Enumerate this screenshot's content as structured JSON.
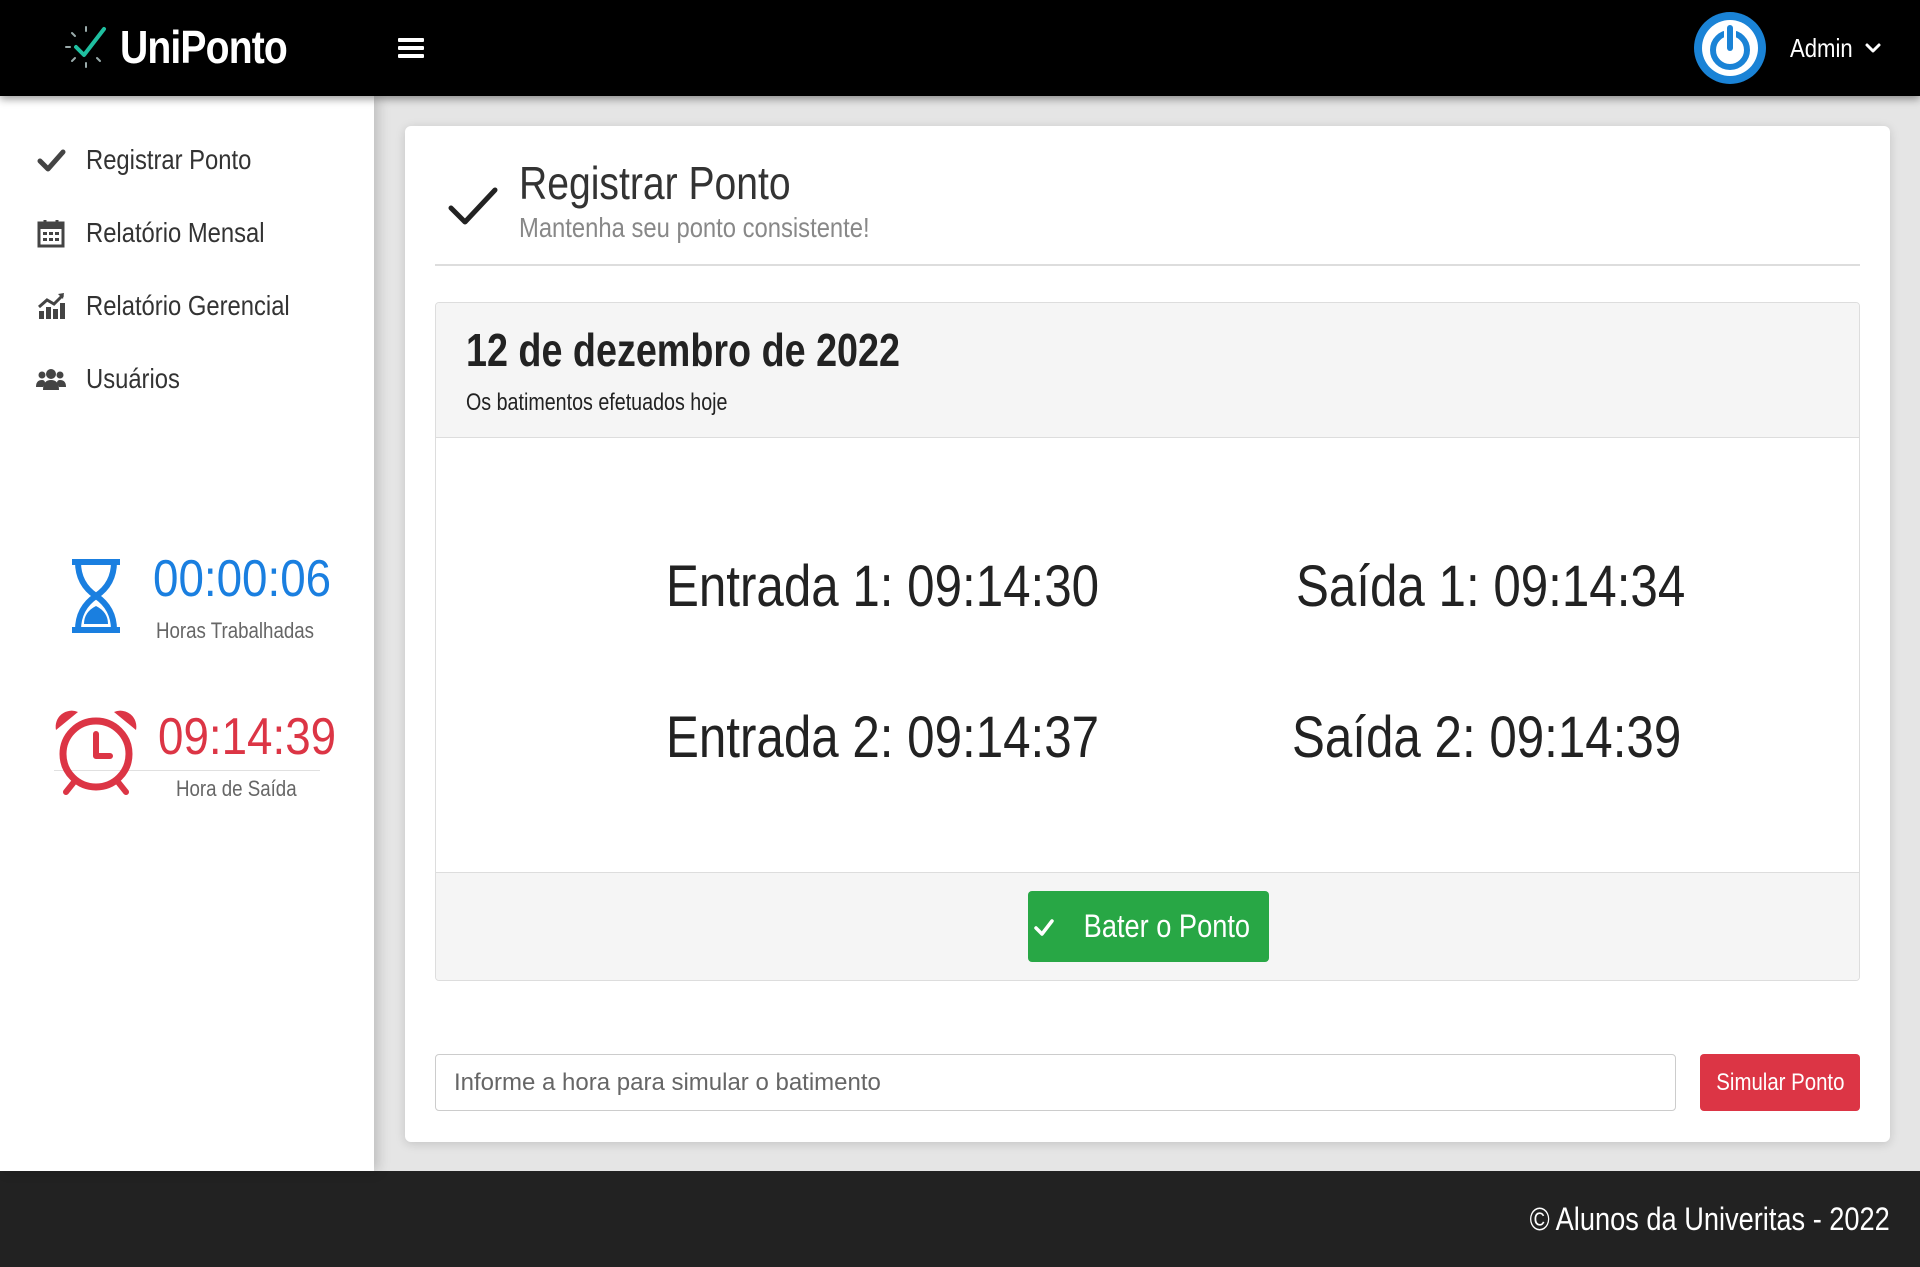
{
  "brand": {
    "name": "UniPonto"
  },
  "user": {
    "name": "Admin"
  },
  "sidebar": {
    "items": [
      {
        "label": "Registrar Ponto",
        "icon": "check-icon"
      },
      {
        "label": "Relatório Mensal",
        "icon": "calendar-icon"
      },
      {
        "label": "Relatório Gerencial",
        "icon": "chart-line-icon"
      },
      {
        "label": "Usuários",
        "icon": "users-icon"
      }
    ],
    "worked": {
      "value": "00:00:06",
      "caption": "Horas Trabalhadas",
      "color": "#1a7fe0"
    },
    "exit": {
      "value": "09:14:39",
      "caption": "Hora de Saída",
      "color": "#dc3545"
    }
  },
  "card": {
    "title": "Registrar Ponto",
    "subtitle": "Mantenha seu ponto consistente!",
    "date_title": "12 de dezembro de 2022",
    "date_subtitle": "Os batimentos efetuados hoje",
    "punches": [
      {
        "label": "Entrada 1: 09:14:30"
      },
      {
        "label": "Saída 1: 09:14:34"
      },
      {
        "label": "Entrada 2: 09:14:37"
      },
      {
        "label": "Saída 2: 09:14:39"
      }
    ],
    "punch_button": "Bater o Ponto",
    "simulate": {
      "placeholder": "Informe a hora para simular o batimento",
      "button": "Simular Ponto"
    }
  },
  "footer": {
    "text": "© Alunos da Univeritas - 2022"
  },
  "colors": {
    "primary": "#1a83d6",
    "success": "#28a745",
    "danger": "#dc3545"
  }
}
